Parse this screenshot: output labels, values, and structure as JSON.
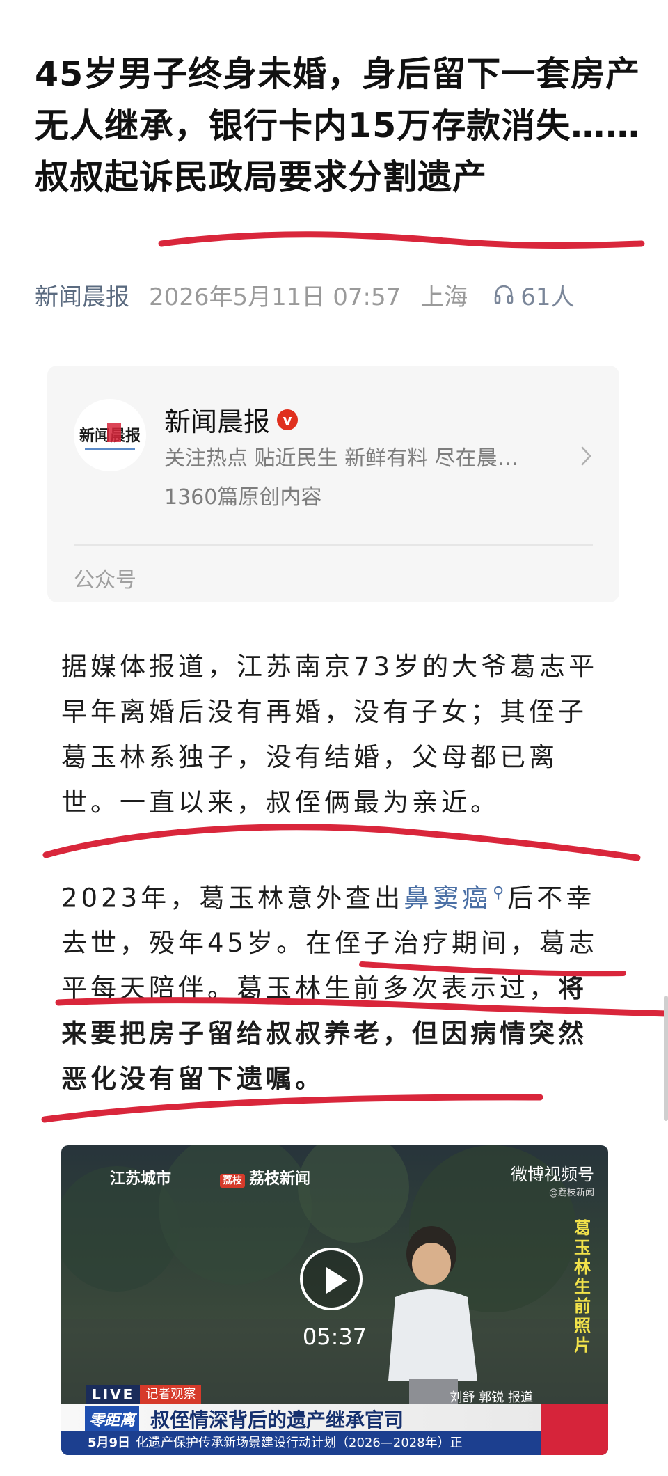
{
  "article": {
    "title": "45岁男子终身未婚，身后留下一套房产无人继承，银行卡内15万存款消失……叔叔起诉民政局要求分割遗产",
    "source": "新闻晨报",
    "datetime": "2026年5月11日 07:57",
    "location": "上海",
    "listeners": "61人"
  },
  "account_card": {
    "name": "新闻晨报",
    "verified_badge": "v",
    "description": "关注热点 贴近民生 新鲜有料 尽在晨…",
    "original_count": "1360篇原创内容",
    "type_label": "公众号",
    "logo_text": "新闻晨报"
  },
  "body": {
    "p1": "据媒体报道，江苏南京73岁的大爷葛志平早年离婚后没有再婚，没有子女；其侄子葛玉林系独子，没有结婚，父母都已离世。一直以来，叔侄俩最为亲近。",
    "p2_before": "2023年，葛玉林意外查出",
    "p2_keyword": "鼻窦癌",
    "p2_after": "后不幸去世，殁年45岁。在侄子治疗期间，葛志平每天陪伴。葛玉林生前多次表示过，",
    "p2_bold": "将来要把房子留给叔叔养老，但因病情突然恶化没有留下遗嘱。"
  },
  "video": {
    "brand_1": "江苏城市",
    "brand_2_tag": "荔枝",
    "brand_2": "荔枝新闻",
    "weibo": "微博视频号",
    "weibo_sub": "@荔枝新闻",
    "side_label": "葛玉林生前照片",
    "duration": "05:37",
    "live": "LIVE",
    "segment": "记者观察",
    "reporter": "刘舒 郭锐 报道",
    "channel": "零距离",
    "headline": "叔侄情深背后的遗产继承官司",
    "ticker_date": "5月9日",
    "ticker_text": "化遗产保护传承新场景建设行动计划（2026—2028年）正"
  },
  "colors": {
    "accent_blue": "#4a6fa5",
    "annotation_red": "#d9263b",
    "verified_red": "#e0301e"
  }
}
